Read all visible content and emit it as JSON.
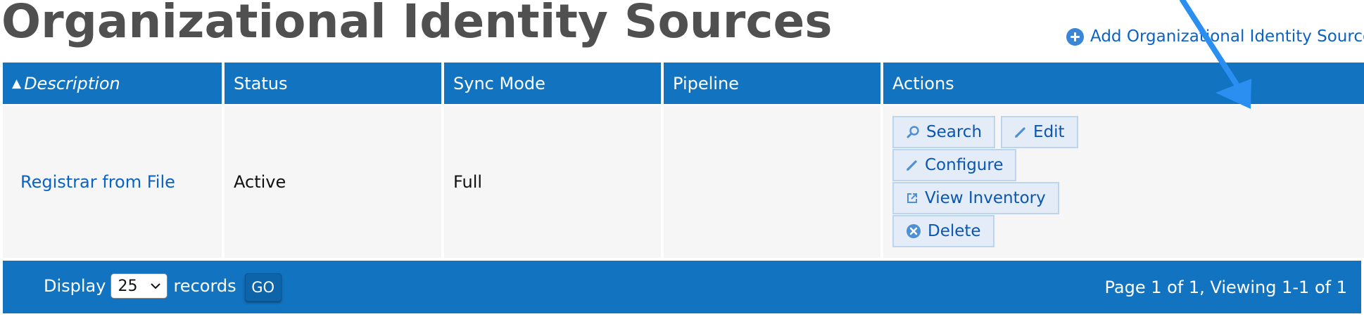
{
  "header": {
    "title": "Organizational Identity Sources",
    "add_link_label": "Add Organizational Identity Source",
    "add_link_icon": "plus-circle-icon"
  },
  "table": {
    "columns": [
      {
        "label": "Description",
        "sorted": "ascending",
        "sort_icon": "▲"
      },
      {
        "label": "Status"
      },
      {
        "label": "Sync Mode"
      },
      {
        "label": "Pipeline"
      },
      {
        "label": "Actions"
      }
    ],
    "rows": [
      {
        "description": "Registrar from File",
        "status": "Active",
        "sync_mode": "Full",
        "pipeline": "",
        "actions": [
          {
            "label": "Search",
            "icon": "search-icon"
          },
          {
            "label": "Edit",
            "icon": "pencil-icon"
          },
          {
            "label": "Configure",
            "icon": "pencil-icon"
          },
          {
            "label": "View Inventory",
            "icon": "external-link-icon"
          },
          {
            "label": "Delete",
            "icon": "delete-circle-icon"
          }
        ]
      }
    ]
  },
  "pager": {
    "display_label": "Display",
    "page_size": "25",
    "records_label": "records",
    "go_label": "GO",
    "summary": "Page 1 of 1, Viewing 1-1 of 1"
  },
  "colors": {
    "header_bg": "#1273c0",
    "link": "#0a63c4",
    "title": "#505050",
    "annotation_arrow": "#2a8ff0"
  }
}
